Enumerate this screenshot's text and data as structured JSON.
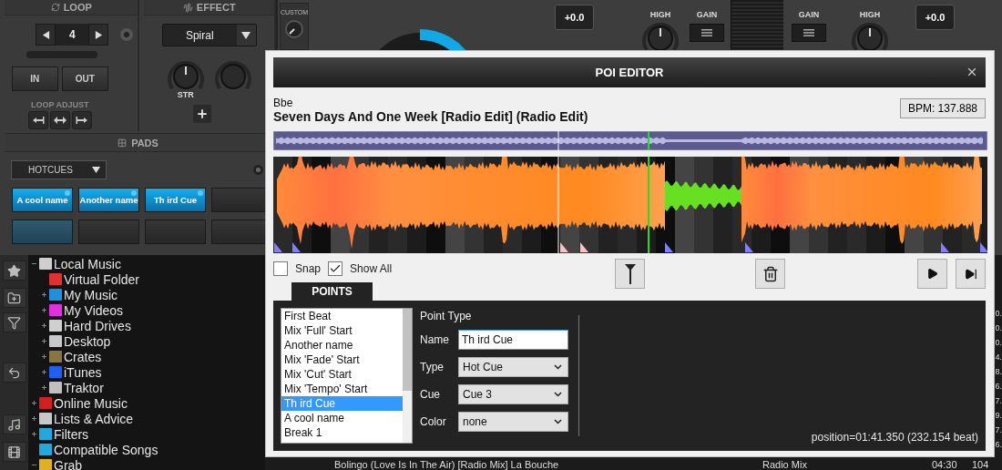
{
  "deck": {
    "loop": {
      "title": "LOOP",
      "length": "4",
      "level": 0,
      "buttons": [
        "IN",
        "OUT"
      ],
      "adjust_label": "LOOP ADJUST"
    },
    "effect": {
      "title": "EFFECT",
      "selected": "Spiral",
      "knob_label": "STR"
    },
    "pads": {
      "title": "PADS",
      "mode": "HOTCUES",
      "items": [
        {
          "label": "A cool name",
          "kind": "cue"
        },
        {
          "label": "Another name",
          "kind": "cue"
        },
        {
          "label": "Th ird Cue",
          "kind": "cue"
        },
        {
          "kind": "empty"
        },
        {
          "kind": "dim"
        },
        {
          "kind": "empty"
        },
        {
          "kind": "empty"
        },
        {
          "kind": "empty"
        }
      ]
    }
  },
  "mixer": {
    "custom_label": "CUSTOM",
    "pitch_left": "+0.0",
    "high_left": "HIGH",
    "gain_left": "GAIN",
    "gain_right": "GAIN",
    "high_right": "HIGH",
    "pitch_right": "+0.0"
  },
  "sidebar": {
    "tree": [
      {
        "label": "Local Music",
        "color": "#cfcfcf",
        "expanded": true,
        "children": [
          {
            "label": "Virtual Folder",
            "color": "#e03030"
          },
          {
            "label": "My Music",
            "color": "#1e90e0",
            "expanded": false
          },
          {
            "label": "My Videos",
            "color": "#e030e0",
            "expanded": false
          },
          {
            "label": "Hard Drives",
            "color": "#d0d0d0",
            "expanded": false
          },
          {
            "label": "Desktop",
            "color": "#c8c8c8",
            "expanded": false
          },
          {
            "label": "Crates",
            "color": "#8a7440",
            "expanded": false
          },
          {
            "label": "iTunes",
            "color": "#2060f0",
            "expanded": false
          },
          {
            "label": "Traktor",
            "color": "#c0c0c0",
            "expanded": false
          }
        ]
      },
      {
        "label": "Online Music",
        "color": "#d02020",
        "expanded": false
      },
      {
        "label": "Lists & Advice",
        "color": "#c8c8c8",
        "expanded": false
      },
      {
        "label": "Filters",
        "color": "#20a8e0",
        "expanded": false
      },
      {
        "label": "Compatible Songs",
        "color": "#20a8e0"
      },
      {
        "label": "Grab",
        "color": "#e0b020",
        "expanded": true
      }
    ]
  },
  "browser": {
    "column_cut": [
      "0.",
      "0.",
      "0.",
      "4.",
      "8.",
      "6.",
      "7.",
      "9.",
      "7.",
      "6."
    ],
    "row": {
      "title": "Bolingo (Love Is In The Air) [Radio Mix] La Bouche",
      "remix": "Radio Mix",
      "length": "04:30",
      "bpm": "104"
    }
  },
  "dialog": {
    "title": "POI EDITOR",
    "artist": "Bbe",
    "track_title": "Seven Days And One Week [Radio Edit] (Radio Edit)",
    "bpm": "BPM: 137.888",
    "snap": {
      "label": "Snap",
      "checked": false
    },
    "show_all": {
      "label": "Show All",
      "checked": true
    },
    "tab": {
      "label": "POINTS",
      "selected": true
    },
    "points": [
      {
        "label": "First Beat",
        "selected": false
      },
      {
        "label": "Mix 'Full' Start",
        "selected": false
      },
      {
        "label": "Another name",
        "selected": false
      },
      {
        "label": "Mix 'Fade' Start",
        "selected": false
      },
      {
        "label": "Mix 'Cut' Start",
        "selected": false
      },
      {
        "label": "Mix 'Tempo' Start",
        "selected": false
      },
      {
        "label": "Th ird Cue",
        "selected": true
      },
      {
        "label": "A cool name",
        "selected": false
      },
      {
        "label": "Break 1",
        "selected": false
      }
    ],
    "form": {
      "heading": "Point Type",
      "fields": [
        {
          "label": "Name",
          "kind": "text",
          "value": "Th ird Cue"
        },
        {
          "label": "Type",
          "kind": "select",
          "value": "Hot Cue"
        },
        {
          "label": "Cue",
          "kind": "select",
          "value": "Cue 3"
        },
        {
          "label": "Color",
          "kind": "select",
          "value": "none"
        }
      ]
    },
    "position": "position=01:41.350 (232.154 beat)"
  }
}
